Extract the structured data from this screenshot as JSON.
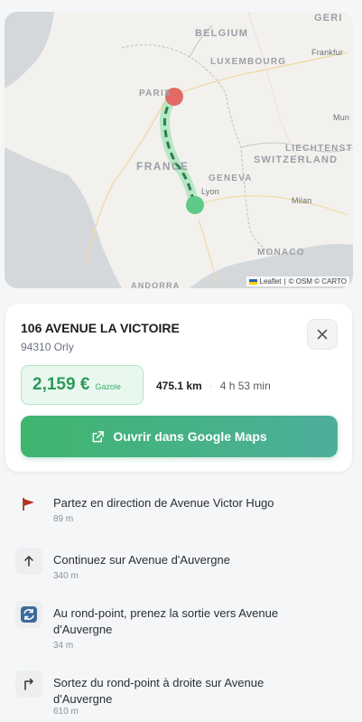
{
  "map": {
    "labels": {
      "belgium": "BELGIUM",
      "luxembourg": "LUXEMBOURG",
      "paris": "PARIS",
      "france": "FRANCE",
      "geneva": "GENEVA",
      "lyon": "Lyon",
      "liechtenstein": "LIECHTENST",
      "switzerland": "SWITZERLAND",
      "milan": "Milan",
      "monaco": "MONACO",
      "frankfurt": "Frankfur",
      "munich": "Mun",
      "germany": "GERI",
      "andorra": "ANDORRA"
    },
    "attribution": {
      "leaflet": "Leaflet",
      "sep1": "|",
      "osm": "© OSM © CARTO"
    },
    "colors": {
      "start": "#e26a66",
      "end": "#5fc98a",
      "route": "#2f7d4d"
    }
  },
  "destination": {
    "title": "106 AVENUE LA VICTOIRE",
    "subtitle": "94310 Orly"
  },
  "price": {
    "value": "2,159 €",
    "fuel": "Gazole"
  },
  "trip": {
    "distance": "475.1 km",
    "separator": "·",
    "duration": "4 h 53 min"
  },
  "actions": {
    "google_maps": "Ouvrir dans Google Maps"
  },
  "steps": [
    {
      "icon": "flag-icon",
      "text": "Partez en direction de Avenue Victor Hugo",
      "distance": "89 m"
    },
    {
      "icon": "arrow-up-icon",
      "text": "Continuez sur Avenue d'Auvergne",
      "distance": "340 m"
    },
    {
      "icon": "roundabout-icon",
      "text": "Au rond-point, prenez la sortie vers Avenue d'Auvergne",
      "distance": "34 m"
    },
    {
      "icon": "turn-right-icon",
      "text": "Sortez du rond-point à droite sur Avenue d'Auvergne",
      "distance": "610 m"
    }
  ]
}
